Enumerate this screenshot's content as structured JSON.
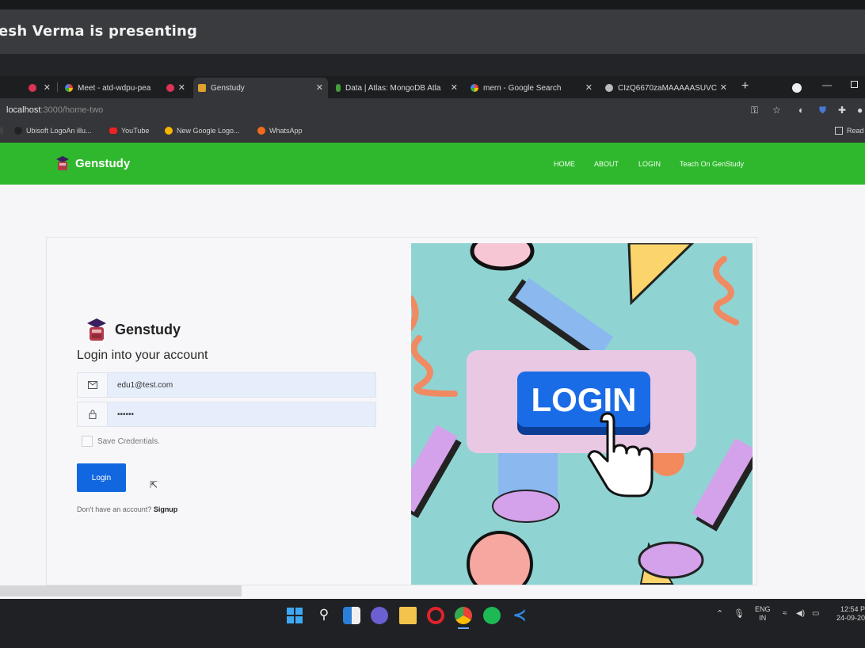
{
  "meet": {
    "presenting_text": "esh Verma is presenting"
  },
  "browser": {
    "tabs": [
      {
        "label": "",
        "fav": "#d35"
      },
      {
        "label": "Meet - atd-wdpu-pea",
        "fav": "#2da44e"
      },
      {
        "label": "",
        "fav": "#d35"
      },
      {
        "label": "Genstudy",
        "fav": "#e0a030"
      },
      {
        "label": "Data | Atlas: MongoDB Atla",
        "fav": "#3fa037"
      },
      {
        "label": "mern - Google Search",
        "fav": "#ffffff"
      },
      {
        "label": "CIzQ6670zaMAAAAASUVC",
        "fav": "#bbbbbb"
      }
    ],
    "new_tab": "+",
    "url_host": "localhost",
    "url_path": ":3000/home-two",
    "bookmarks": [
      {
        "label": "Ubisoft LogoAn illu...",
        "color": "#222"
      },
      {
        "label": "YouTube",
        "color": "#e22"
      },
      {
        "label": "New Google Logo...",
        "color": "#f4b400"
      },
      {
        "label": "WhatsApp",
        "color": "#f26b1d"
      }
    ],
    "reading_list": "Read"
  },
  "site": {
    "brand": "Genstudy",
    "nav": [
      "HOME",
      "ABOUT",
      "LOGIN",
      "Teach On GenStudy"
    ],
    "form": {
      "brand": "Genstudy",
      "heading": "Login into your account",
      "email_value": "edu1@test.com",
      "password_value": "••••••",
      "save_label": "Save Credentials.",
      "login_label": "Login",
      "signup_prompt": "Don't have an account?",
      "signup_link": "Signup"
    },
    "hero_button_text": "LOGIN"
  },
  "taskbar": {
    "lang_top": "ENG",
    "lang_bottom": "IN",
    "time": "12:54 P",
    "date": "24-09-20"
  },
  "colors": {
    "nav_green": "#2fb82d",
    "primary_blue": "#1067e0"
  }
}
